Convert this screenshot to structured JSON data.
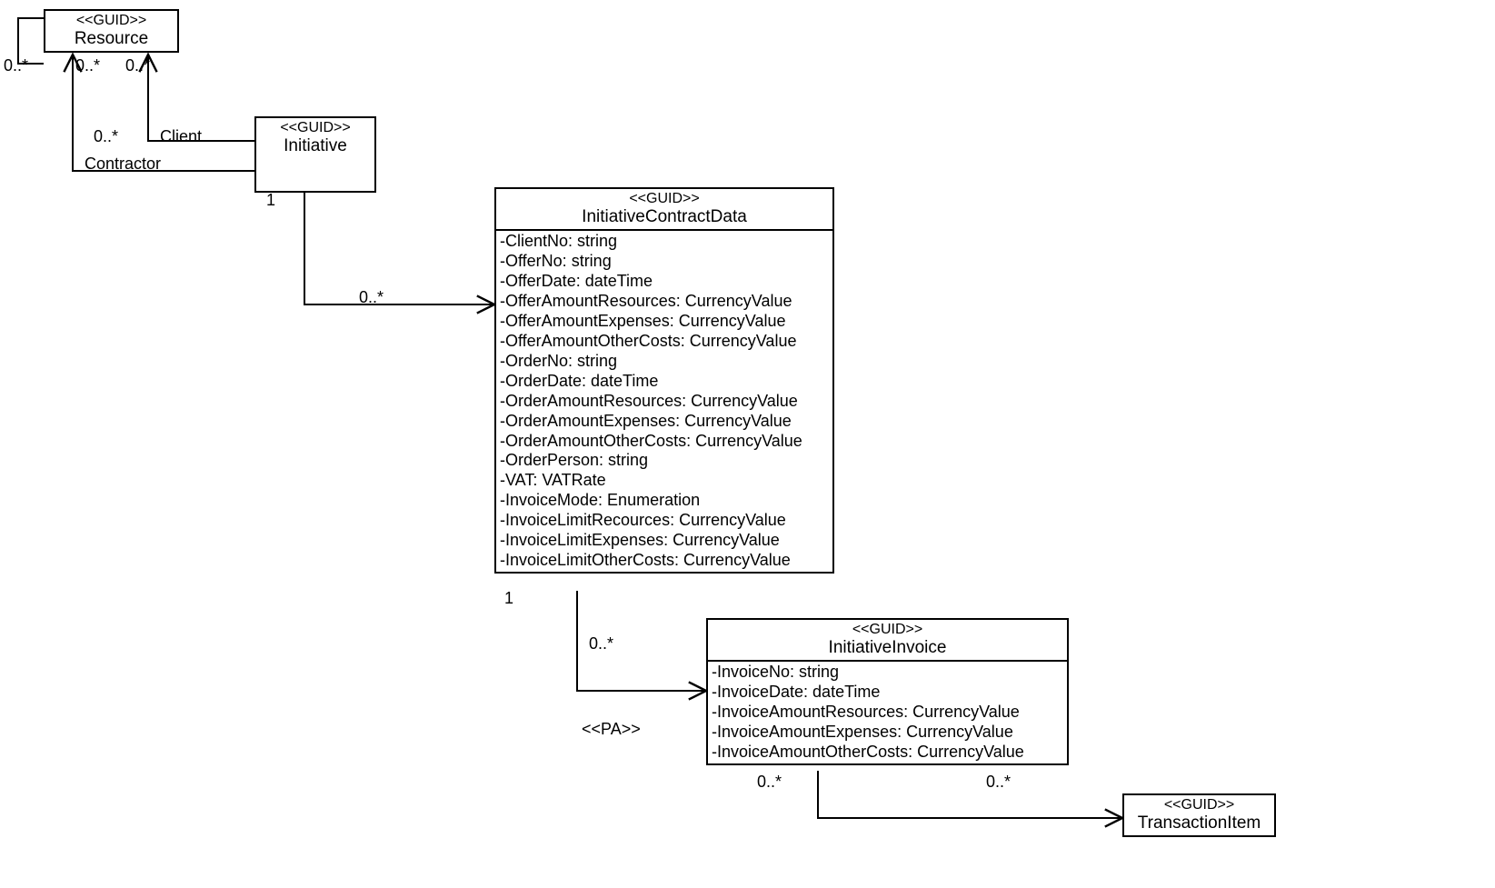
{
  "classes": {
    "resource": {
      "stereotype": "<<GUID>>",
      "name": "Resource",
      "attributes": []
    },
    "initiative": {
      "stereotype": "<<GUID>>",
      "name": "Initiative",
      "attributes": []
    },
    "initiativeContractData": {
      "stereotype": "<<GUID>>",
      "name": "InitiativeContractData",
      "attributes": [
        "-ClientNo: string",
        "-OfferNo: string",
        "-OfferDate: dateTime",
        "-OfferAmountResources: CurrencyValue",
        "-OfferAmountExpenses: CurrencyValue",
        "-OfferAmountOtherCosts: CurrencyValue",
        "-OrderNo: string",
        "-OrderDate: dateTime",
        "-OrderAmountResources: CurrencyValue",
        "-OrderAmountExpenses: CurrencyValue",
        "-OrderAmountOtherCosts: CurrencyValue",
        "-OrderPerson: string",
        "-VAT: VATRate",
        "-InvoiceMode: Enumeration",
        "-InvoiceLimitRecources: CurrencyValue",
        "-InvoiceLimitExpenses: CurrencyValue",
        "-InvoiceLimitOtherCosts: CurrencyValue"
      ]
    },
    "initiativeInvoice": {
      "stereotype": "<<GUID>>",
      "name": "InitiativeInvoice",
      "attributes": [
        "-InvoiceNo: string",
        "-InvoiceDate: dateTime",
        "-InvoiceAmountResources: CurrencyValue",
        "-InvoiceAmountExpenses: CurrencyValue",
        "-InvoiceAmountOtherCosts: CurrencyValue"
      ]
    },
    "transactionItem": {
      "stereotype": "<<GUID>>",
      "name": "TransactionItem",
      "attributes": []
    }
  },
  "labels": {
    "resource_self": "0..*",
    "client_role": "Client",
    "contractor_role": "Contractor",
    "client_near_resource": "0..*",
    "contractor_near_resource": "0..*",
    "client_near_initiative": "0..*",
    "initiative_contract_near_initiative": "1",
    "initiative_contract_near_contract": "0..*",
    "contract_invoice_near_contract": "1",
    "contract_invoice_near_invoice": "0..*",
    "pa_stereotype": "<<PA>>",
    "invoice_transaction_near_invoice": "0..*",
    "invoice_transaction_near_transaction": "0..*"
  }
}
